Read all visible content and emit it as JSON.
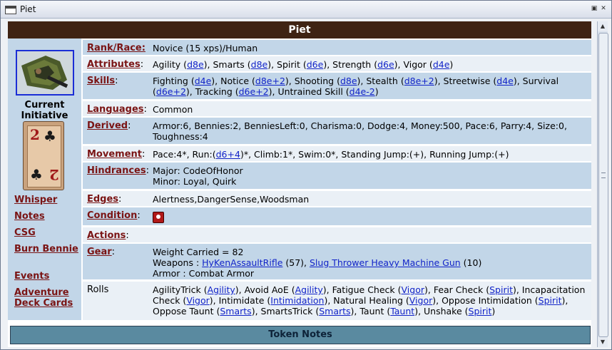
{
  "window": {
    "title": "Piet"
  },
  "sheet": {
    "name": "Piet",
    "initiative_label": "Current Initiative",
    "initiative_card": {
      "rank": "2",
      "suit": "clubs"
    },
    "side_links": [
      "Whisper",
      "Notes",
      "CSG",
      "Burn Bennie",
      "Events",
      "Adventure Deck Cards"
    ],
    "rows": [
      {
        "label": "Rank/Race:",
        "parts": [
          {
            "t": "Novice (15 xps)/Human"
          }
        ]
      },
      {
        "label": "Attributes",
        "suffix": ":",
        "parts": [
          {
            "t": "Agility ("
          },
          {
            "l": "d8e"
          },
          {
            "t": "), Smarts ("
          },
          {
            "l": "d8e"
          },
          {
            "t": "), Spirit ("
          },
          {
            "l": "d6e"
          },
          {
            "t": "), Strength ("
          },
          {
            "l": "d6e"
          },
          {
            "t": "), Vigor ("
          },
          {
            "l": "d4e"
          },
          {
            "t": ")"
          }
        ]
      },
      {
        "label": "Skills",
        "suffix": ":",
        "parts": [
          {
            "t": "Fighting ("
          },
          {
            "l": "d4e"
          },
          {
            "t": "), Notice ("
          },
          {
            "l": "d8e+2"
          },
          {
            "t": "), Shooting ("
          },
          {
            "l": "d8e"
          },
          {
            "t": "), Stealth ("
          },
          {
            "l": "d8e+2"
          },
          {
            "t": "), Streetwise ("
          },
          {
            "l": "d4e"
          },
          {
            "t": "), Survival ("
          },
          {
            "l": "d6e+2"
          },
          {
            "t": "), Tracking ("
          },
          {
            "l": "d6e+2"
          },
          {
            "t": "), Untrained Skill ("
          },
          {
            "l": "d4e-2"
          },
          {
            "t": ")"
          }
        ]
      },
      {
        "label": "Languages",
        "suffix": ":",
        "parts": [
          {
            "t": "Common"
          }
        ]
      },
      {
        "label": "Derived",
        "suffix": ":",
        "parts": [
          {
            "t": "Armor:6, Bennies:2, BenniesLeft:0, Charisma:0, Dodge:4, Money:500, Pace:6, Parry:4, Size:0, Toughness:4"
          }
        ]
      },
      {
        "label": "Movement",
        "suffix": ":",
        "parts": [
          {
            "t": "Pace:4*, Run:("
          },
          {
            "l": "d6+4"
          },
          {
            "t": ")*, Climb:1*, Swim:0*, Standing Jump:(+), Running Jump:(+)"
          }
        ]
      },
      {
        "label": "Hindrances",
        "suffix": ":",
        "parts": [
          {
            "t": "Major: CodeOfHonor"
          },
          {
            "br": true
          },
          {
            "t": "Minor: Loyal, Quirk"
          }
        ]
      },
      {
        "label": "Edges",
        "suffix": ":",
        "parts": [
          {
            "t": "Alertness,DangerSense,Woodsman"
          }
        ]
      },
      {
        "label": "Condition",
        "suffix": ":",
        "icon": "skull-condition-icon",
        "parts": []
      },
      {
        "label": "Actions",
        "suffix": ":",
        "parts": []
      },
      {
        "label": "Gear",
        "suffix": ":",
        "parts": [
          {
            "t": "Weight Carried = 82"
          },
          {
            "br": true
          },
          {
            "t": "Weapons : "
          },
          {
            "l": "HyKenAssaultRifle"
          },
          {
            "t": " (57), "
          },
          {
            "l": "Slug Thrower Heavy Machine Gun"
          },
          {
            "t": " (10)"
          },
          {
            "br": true
          },
          {
            "t": "Armor : Combat Armor"
          }
        ]
      },
      {
        "label": "Rolls",
        "plain": true,
        "parts": [
          {
            "t": "AgilityTrick ("
          },
          {
            "l": "Agility"
          },
          {
            "t": "), Avoid AoE ("
          },
          {
            "l": "Agility"
          },
          {
            "t": "), Fatigue Check ("
          },
          {
            "l": "Vigor"
          },
          {
            "t": "), Fear Check ("
          },
          {
            "l": "Spirit"
          },
          {
            "t": "), Incapacitation Check ("
          },
          {
            "l": "Vigor"
          },
          {
            "t": "), Intimidate ("
          },
          {
            "l": "Intimidation"
          },
          {
            "t": "), Natural Healing ("
          },
          {
            "l": "Vigor"
          },
          {
            "t": "), Oppose Intimidation ("
          },
          {
            "l": "Spirit"
          },
          {
            "t": "), Oppose Taunt ("
          },
          {
            "l": "Smarts"
          },
          {
            "t": "), SmartsTrick ("
          },
          {
            "l": "Smarts"
          },
          {
            "t": "), Taunt ("
          },
          {
            "l": "Taunt"
          },
          {
            "t": "), Unshake ("
          },
          {
            "l": "Spirit"
          },
          {
            "t": ")"
          }
        ]
      }
    ],
    "token_notes": "Token Notes"
  },
  "colors": {
    "header": "#3f2313",
    "row_blue": "#c2d6e8",
    "row_light": "#eaf0f6",
    "link_red": "#7a1414",
    "link_blue": "#1224c8"
  }
}
